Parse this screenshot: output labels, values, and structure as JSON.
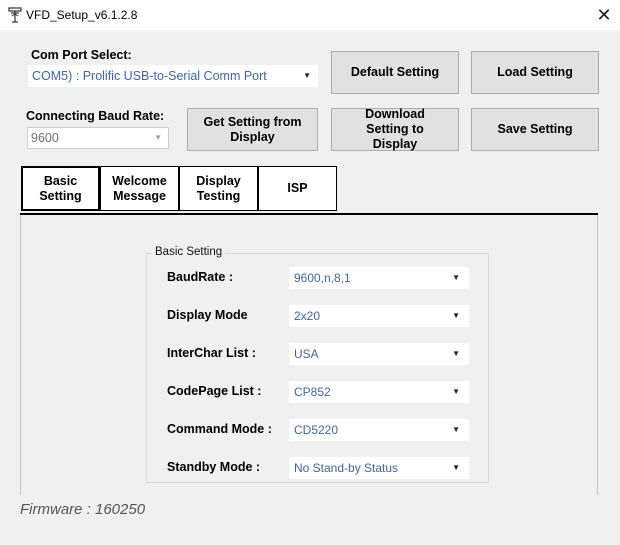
{
  "window": {
    "title": "VFD_Setup_v6.1.2.8",
    "close_glyph": "✕"
  },
  "com_port": {
    "label": "Com Port Select:",
    "value": "COM5) : Prolific USB-to-Serial Comm Port"
  },
  "baud": {
    "label": "Connecting Baud Rate:",
    "value": "9600"
  },
  "buttons": {
    "default_setting": "Default Setting",
    "load_setting": "Load Setting",
    "get_setting": "Get Setting from Display",
    "download_setting": "Download Setting to Display",
    "save_setting": "Save Setting"
  },
  "tabs": [
    {
      "label": "Basic Setting",
      "active": true
    },
    {
      "label": "Welcome Message",
      "active": false
    },
    {
      "label": "Display Testing",
      "active": false
    },
    {
      "label": "ISP",
      "active": false
    }
  ],
  "basic_setting": {
    "group_title": "Basic Setting",
    "rows": [
      {
        "label": "BaudRate :",
        "value": "9600,n,8,1"
      },
      {
        "label": "Display Mode",
        "value": "2x20"
      },
      {
        "label": "InterChar  List :",
        "value": "USA"
      },
      {
        "label": "CodePage List :",
        "value": "CP852"
      },
      {
        "label": "Command Mode :",
        "value": "CD5220"
      },
      {
        "label": "Standby Mode :",
        "value": "No Stand-by Status"
      }
    ]
  },
  "firmware": "Firmware : 160250",
  "dropdown_arrow": "▼"
}
